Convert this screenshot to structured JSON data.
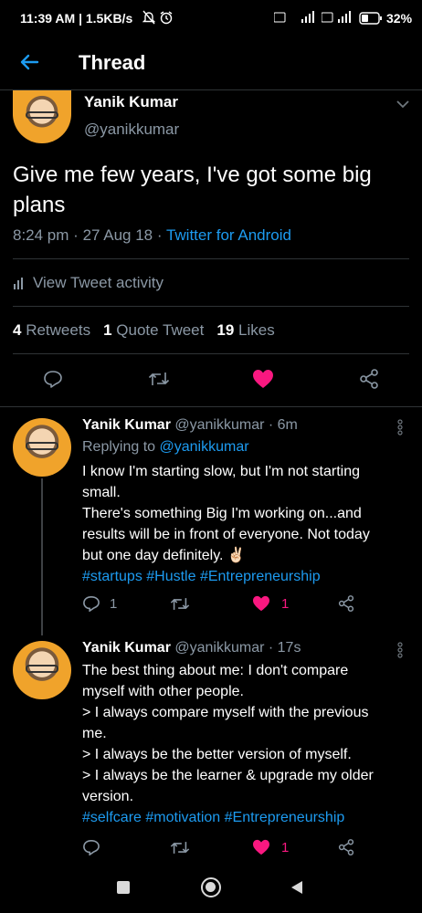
{
  "status_bar": {
    "time": "11:39 AM | 1.5KB/s",
    "battery": "32%"
  },
  "header": {
    "title": "Thread"
  },
  "main_tweet": {
    "author_name": "Yanik Kumar",
    "handle": "@yanikkumar",
    "text_line1": "Give me few years, I've got some big",
    "text_line2": "plans",
    "time": "8:24 pm",
    "date": "27 Aug 18",
    "source": "Twitter for Android",
    "activity_label": "View Tweet activity",
    "retweets_count": "4",
    "retweets_label": "Retweets",
    "quotes_count": "1",
    "quotes_label": "Quote Tweet",
    "likes_count": "19",
    "likes_label": "Likes"
  },
  "replies": [
    {
      "author_name": "Yanik Kumar",
      "handle_time": "@yanikkumar · 6m",
      "replying_prefix": "Replying to",
      "replying_to": "@yanikkumar",
      "lines": [
        "I know I'm starting slow, but I'm not starting",
        "small.",
        "There's something Big I'm working on...and",
        "results will be in front of everyone. Not today",
        "but one day definitely. ✌🏻"
      ],
      "hashtags": "#startups #Hustle #Entrepreneurship",
      "reply_count": "1",
      "like_count": "1"
    },
    {
      "author_name": "Yanik Kumar",
      "handle_time": "@yanikkumar · 17s",
      "lines": [
        "The best thing about me: I don't compare",
        "myself with other people.",
        "> I always compare myself with the previous",
        "me.",
        "> I always be the better version of myself.",
        "> I always be the learner & upgrade my older",
        "version."
      ],
      "hashtags": "#selfcare #motivation #Entrepreneurship",
      "like_count": "1"
    }
  ],
  "colors": {
    "accent": "#1d9bf0",
    "like": "#f91880",
    "muted": "#8b98a5"
  }
}
